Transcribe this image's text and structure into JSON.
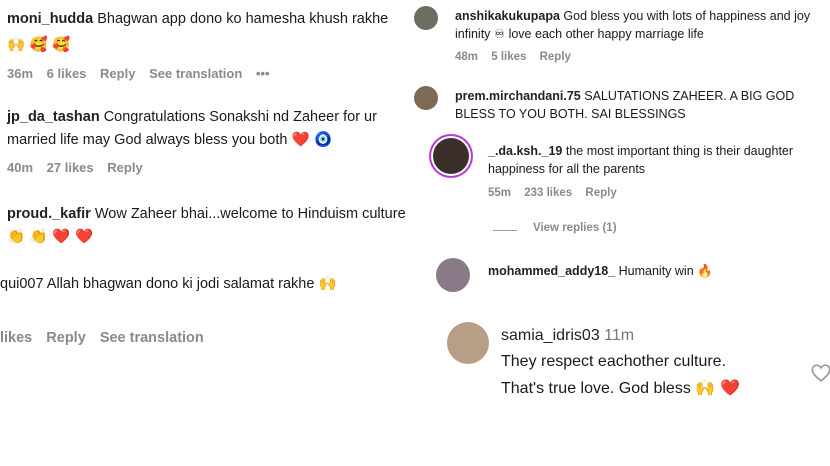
{
  "left": {
    "c1": {
      "user": "moni_hudda",
      "text": "Bhagwan app dono ko hamesha khush rakhe",
      "emojis": "🙌 🥰 🥰",
      "time": "36m",
      "likes": "6 likes",
      "reply": "Reply",
      "translate": "See translation",
      "more": "•••"
    },
    "c2": {
      "user": "jp_da_tashan",
      "text1": "Congratulations Sonakshi nd Zaheer for ur",
      "text2": "married life may God always bless you both",
      "emojis": "❤️ 🧿",
      "time": "40m",
      "likes": "27 likes",
      "reply": "Reply"
    },
    "c3": {
      "user": "proud._kafir",
      "text": "Wow Zaheer bhai...welcome to Hinduism culture",
      "emojis": "👏 👏 ❤️ ❤️"
    },
    "c4": {
      "user": "qui007",
      "text": "Allah bhagwan dono ki jodi salamat rakhe",
      "emojis": "🙌",
      "likes": "likes",
      "reply": "Reply",
      "translate": "See translation"
    }
  },
  "right": {
    "r1": {
      "user": "anshikakukupapa",
      "text1": "God bless you with lots of happiness and joy",
      "text2": "infinity ♾ love each other happy marriage life",
      "time": "48m",
      "likes": "5 likes",
      "reply": "Reply"
    },
    "r2": {
      "user": "prem.mirchandani.75",
      "text1": "SALUTATIONS ZAHEER. A BIG GOD",
      "text2": "BLESS TO YOU BOTH. SAI BLESSINGS"
    },
    "r3": {
      "user": "_.da.ksh._19",
      "text1": "the most important thing is their daughter",
      "text2": "happiness for all the parents",
      "time": "55m",
      "likes": "233 likes",
      "reply": "Reply",
      "view_replies": "View replies (1)"
    },
    "r4": {
      "user": "mohammed_addy18_",
      "text": "Humanity win",
      "emoji": "🔥"
    },
    "r5": {
      "user": "samia_idris03",
      "time": "11m",
      "text1": "They respect eachother culture.",
      "text2": "That's true love. God bless",
      "emojis": "🙌 ❤️"
    }
  }
}
